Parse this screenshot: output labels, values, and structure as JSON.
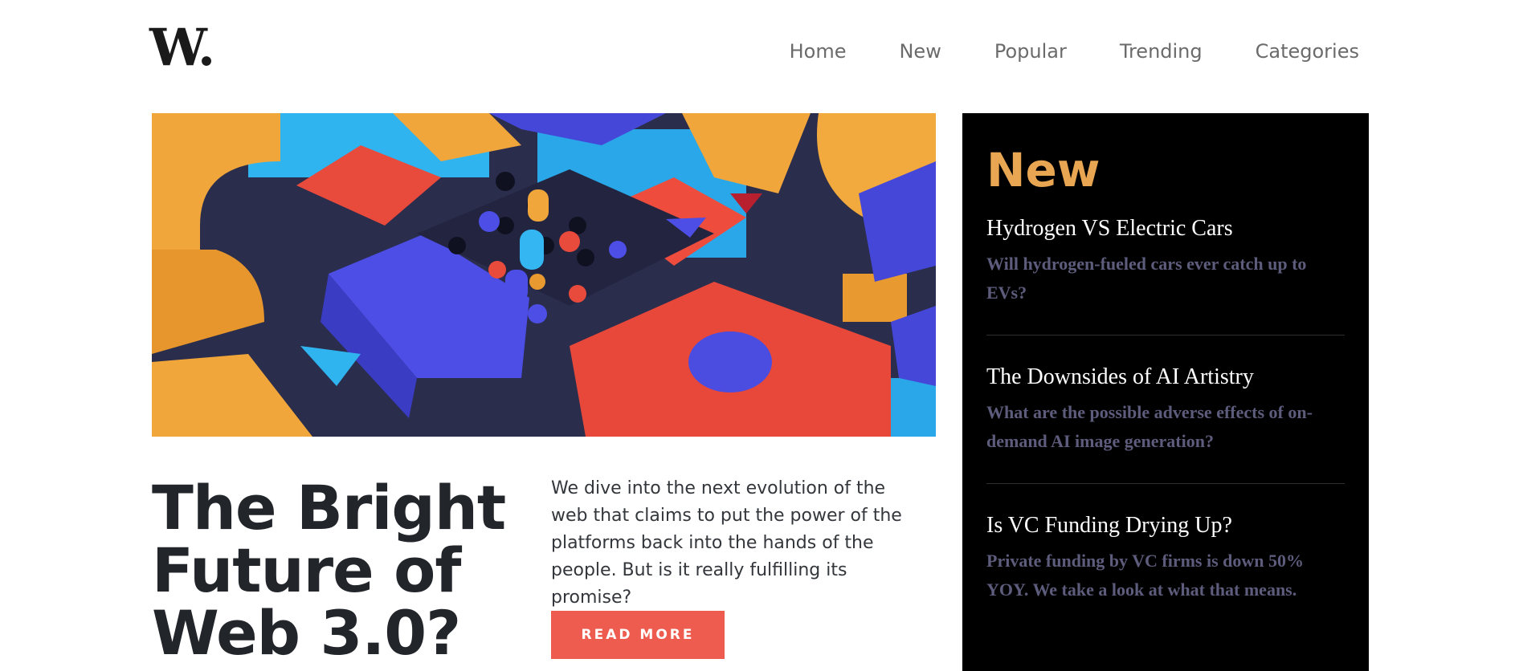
{
  "brand": {
    "logo": "W."
  },
  "nav": {
    "items": [
      {
        "label": "Home"
      },
      {
        "label": "New"
      },
      {
        "label": "Popular"
      },
      {
        "label": "Trending"
      },
      {
        "label": "Categories"
      }
    ]
  },
  "hero": {
    "title": "The Bright Future of Web 3.0?",
    "summary": "We dive into the next evolution of the web that claims to put the power of the platforms back into the hands of the people. But is it really fulfilling its promise?",
    "button_label": "READ MORE"
  },
  "sidebar": {
    "heading": "New",
    "items": [
      {
        "title": "Hydrogen VS Electric Cars",
        "description": "Will hydrogen-fueled cars ever catch up to EVs?"
      },
      {
        "title": "The Downsides of AI Artistry",
        "description": "What are the possible adverse effects of on-demand AI image generation?"
      },
      {
        "title": "Is VC Funding Drying Up?",
        "description": "Private funding by VC firms is down 50% YOY. We take a look at what that means."
      }
    ]
  },
  "colors": {
    "accent": "#ee5b4f",
    "sidebar_heading": "#e8a552",
    "sidebar_bg": "#000000",
    "sidebar_desc": "#5d5c7c"
  }
}
